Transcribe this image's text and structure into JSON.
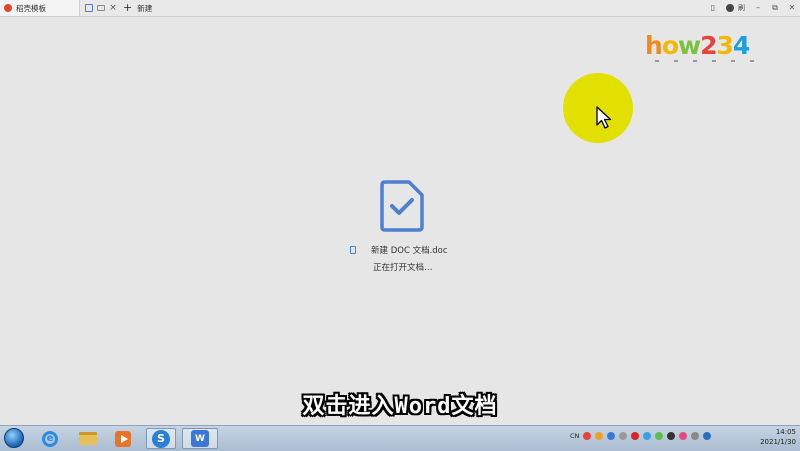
{
  "tabs": {
    "template_tab_label": "稻壳模板",
    "new_tab_label": "新建",
    "user_label": "刷"
  },
  "watermark": {
    "letters": [
      "h",
      "o",
      "w",
      "2",
      "3",
      "4"
    ],
    "colors": [
      "#f08a1c",
      "#f5b700",
      "#7cc242",
      "#e8433a",
      "#f5b700",
      "#1ea0e0"
    ]
  },
  "loader": {
    "file_name": "新建 DOC 文档.doc",
    "status": "正在打开文档…",
    "accent_color": "#4f7fd0"
  },
  "subtitle": "双击进入Word文档",
  "taskbar": {
    "apps": [
      "start-orb",
      "internet-explorer",
      "file-explorer",
      "media-player",
      "sogou-browser",
      "wps-office"
    ],
    "tray_lang": "CN",
    "clock_time": "14:05",
    "clock_date": "2021/1/30"
  },
  "colors": {
    "background": "#e6e6e6",
    "cursor_highlight": "#e2e000"
  }
}
